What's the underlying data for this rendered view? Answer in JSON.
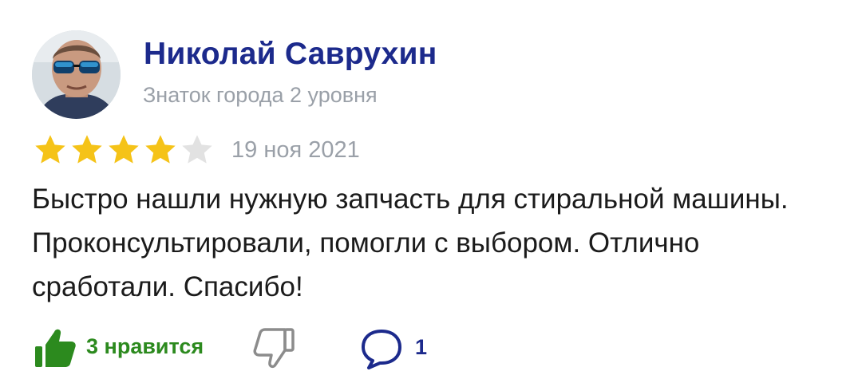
{
  "author": {
    "name": "Николай Саврухин",
    "level": "Знаток города 2 уровня"
  },
  "review": {
    "rating": 4,
    "rating_max": 5,
    "date": "19 ноя 2021",
    "text": "Быстро нашли нужную запчасть для стиральной машины. Проконсультировали, помогли с выбором. Отлично сработали. Спасибо!"
  },
  "actions": {
    "like_label": "3 нравится",
    "comment_count": "1"
  },
  "colors": {
    "name": "#1c2a8c",
    "star_filled": "#f5c318",
    "star_empty": "#e2e2e2",
    "like": "#2c8a1e",
    "dislike": "#8c8c8c",
    "comment": "#1c2a8c",
    "muted_text": "#9aa0a8"
  },
  "icons": {
    "avatar": "user-photo",
    "like": "thumbs-up-icon",
    "dislike": "thumbs-down-icon",
    "comment": "comment-bubble-icon"
  }
}
